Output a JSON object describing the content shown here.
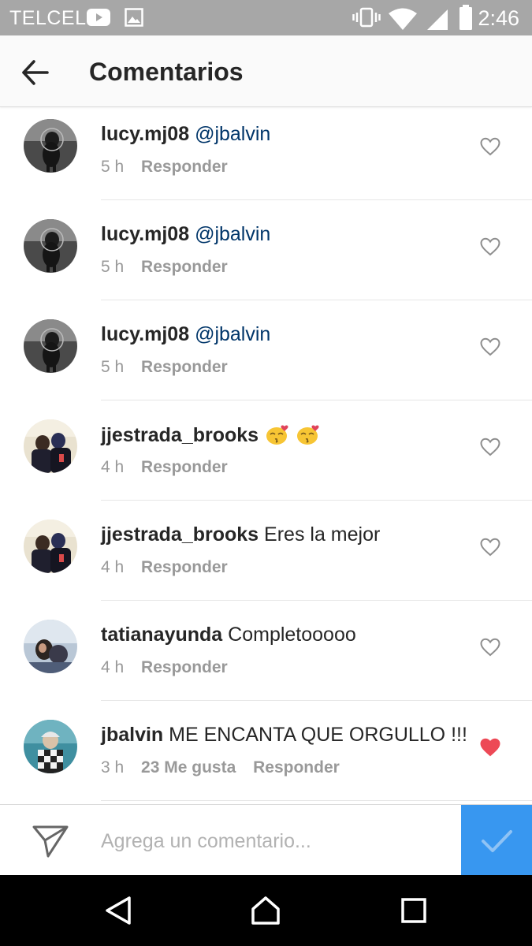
{
  "status_bar": {
    "carrier": "TELCEL",
    "time": "2:46",
    "icons": [
      "youtube-icon",
      "image-icon",
      "vibrate-icon",
      "wifi-icon",
      "signal-icon",
      "battery-icon"
    ]
  },
  "header": {
    "title": "Comentarios",
    "back_icon": "arrow-left-icon"
  },
  "comments": [
    {
      "username": "lucy.mj08",
      "mention": "@jbalvin",
      "text": "",
      "time": "5 h",
      "likes": "",
      "reply": "Responder",
      "liked": false
    },
    {
      "username": "lucy.mj08",
      "mention": "@jbalvin",
      "text": "",
      "time": "5 h",
      "likes": "",
      "reply": "Responder",
      "liked": false
    },
    {
      "username": "lucy.mj08",
      "mention": "@jbalvin",
      "text": "",
      "time": "5 h",
      "likes": "",
      "reply": "Responder",
      "liked": false
    },
    {
      "username": "jjestrada_brooks",
      "mention": "",
      "text": "",
      "emoji": [
        "kissing-face-emoji",
        "kissing-face-emoji"
      ],
      "time": "4 h",
      "likes": "",
      "reply": "Responder",
      "liked": false
    },
    {
      "username": "jjestrada_brooks",
      "mention": "",
      "text": "Eres la mejor",
      "time": "4 h",
      "likes": "",
      "reply": "Responder",
      "liked": false
    },
    {
      "username": "tatianayunda",
      "mention": "",
      "text": "Completooooo",
      "time": "4 h",
      "likes": "",
      "reply": "Responder",
      "liked": false
    },
    {
      "username": "jbalvin",
      "mention": "",
      "text": "ME ENCANTA QUE ORGULLO !!!",
      "time": "3 h",
      "likes": "23 Me gusta",
      "reply": "Responder",
      "liked": true
    }
  ],
  "composer": {
    "placeholder": "Agrega un comentario...",
    "value": ""
  },
  "colors": {
    "status_bar": "#a7a7a7",
    "accent_blue": "#3897f0",
    "mention_blue": "#003569",
    "liked_red": "#ed4956",
    "meta_gray": "#999999"
  }
}
